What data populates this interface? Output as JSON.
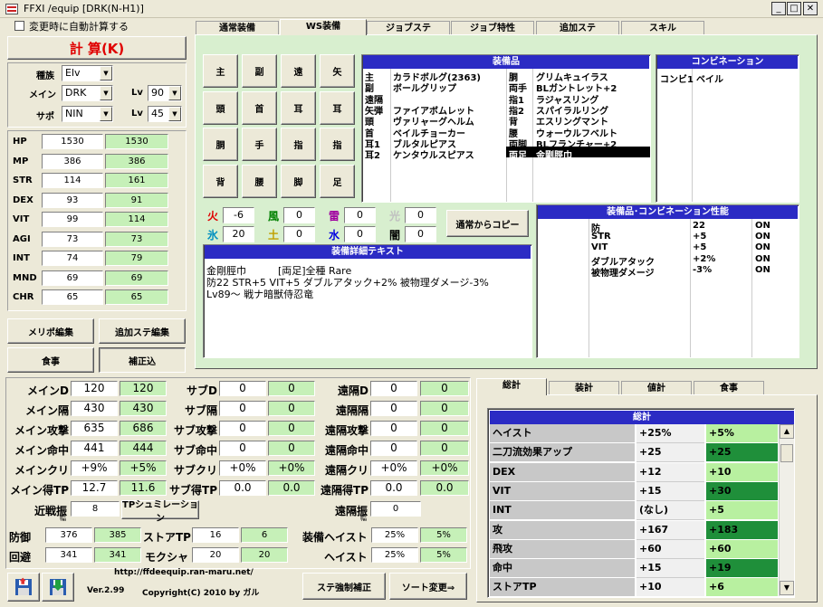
{
  "window": {
    "title": "FFXI /equip [DRK(N-H1)]"
  },
  "autocalc_label": "変更時に自動計算する",
  "calc_button": "計 算(K)",
  "job": {
    "race_label": "種族",
    "race": "Elv",
    "main_label": "メイン",
    "main": "DRK",
    "sub_label": "サポ",
    "sub": "NIN",
    "lv_label": "Lv",
    "main_lv": "90",
    "sub_lv": "45"
  },
  "stats": [
    {
      "name": "HP",
      "base": "1530",
      "total": "1530"
    },
    {
      "name": "MP",
      "base": "386",
      "total": "386"
    },
    {
      "name": "STR",
      "base": "114",
      "total": "161"
    },
    {
      "name": "DEX",
      "base": "93",
      "total": "91"
    },
    {
      "name": "VIT",
      "base": "99",
      "total": "114"
    },
    {
      "name": "AGI",
      "base": "73",
      "total": "73"
    },
    {
      "name": "INT",
      "base": "74",
      "total": "79"
    },
    {
      "name": "MND",
      "base": "69",
      "total": "69"
    },
    {
      "name": "CHR",
      "base": "65",
      "total": "65"
    }
  ],
  "left_buttons": {
    "merit": "メリポ編集",
    "extra": "追加ステ編集",
    "food": "食事",
    "correction": "補正込"
  },
  "tabs": [
    "通常装備",
    "WS装備",
    "ジョブステ",
    "ジョブ特性",
    "追加ステ",
    "スキル"
  ],
  "slots": [
    "主",
    "副",
    "遠",
    "矢",
    "頭",
    "首",
    "耳",
    "耳",
    "胴",
    "手",
    "指",
    "指",
    "背",
    "腰",
    "脚",
    "足"
  ],
  "equip": {
    "header": "装備品",
    "left": [
      {
        "slot": "主",
        "item": "カラドボルグ(2363)"
      },
      {
        "slot": "副",
        "item": "ボールグリップ"
      },
      {
        "slot": "遠隔",
        "item": ""
      },
      {
        "slot": "矢弾",
        "item": "ファイアボムレット"
      },
      {
        "slot": "頭",
        "item": "ヴァリャーグヘルム"
      },
      {
        "slot": "首",
        "item": "ベイルチョーカー"
      },
      {
        "slot": "耳1",
        "item": "ブルタルピアス"
      },
      {
        "slot": "耳2",
        "item": "ケンタウルスピアス"
      }
    ],
    "right": [
      {
        "slot": "胴",
        "item": "グリムキュイラス"
      },
      {
        "slot": "両手",
        "item": "BLガントレット+2"
      },
      {
        "slot": "指1",
        "item": "ラジャスリング"
      },
      {
        "slot": "指2",
        "item": "スパイラルリング"
      },
      {
        "slot": "背",
        "item": "エスリングマント"
      },
      {
        "slot": "腰",
        "item": "ウォーウルフベルト"
      },
      {
        "slot": "両脚",
        "item": "BLフランチャー+2"
      },
      {
        "slot": "両足",
        "item": "金剛脛巾"
      }
    ]
  },
  "combination": {
    "header": "コンビネーション",
    "rows": [
      {
        "name": "コンビ1",
        "value": "ベイル"
      }
    ]
  },
  "elements": [
    {
      "name": "火",
      "value": "-6",
      "color": "#e00000"
    },
    {
      "name": "風",
      "value": "0",
      "color": "#008000"
    },
    {
      "name": "雷",
      "value": "0",
      "color": "#a000a0"
    },
    {
      "name": "光",
      "value": "0",
      "color": "#c0c0c0"
    },
    {
      "name": "氷",
      "value": "20",
      "color": "#0090c0"
    },
    {
      "name": "土",
      "value": "0",
      "color": "#c0a000"
    },
    {
      "name": "水",
      "value": "0",
      "color": "#0000e0"
    },
    {
      "name": "闇",
      "value": "0",
      "color": "#000000"
    }
  ],
  "copy_button": "通常からコピー",
  "combo_perf": {
    "header": "装備品･コンビネーション性能",
    "rows": [
      {
        "name": "防",
        "value": "22",
        "state": "ON"
      },
      {
        "name": "STR",
        "value": "+5",
        "state": "ON"
      },
      {
        "name": "VIT",
        "value": "+5",
        "state": "ON"
      },
      {
        "name": "ダブルアタック",
        "value": "+2%",
        "state": "ON"
      },
      {
        "name": "被物理ダメージ",
        "value": "-3%",
        "state": "ON"
      }
    ]
  },
  "detail": {
    "header": "装備詳細テキスト",
    "lines": [
      "金剛脛巾          [両足]全種 Rare",
      "防22 STR+5 VIT+5 ダブルアタック+2% 被物理ダメージ-3%",
      "Lv89～ 戦ナ暗獣侍忍竜"
    ]
  },
  "combat": {
    "rows": [
      [
        {
          "l": "メインD",
          "a": "120",
          "b": "120"
        },
        {
          "l": "サブD",
          "a": "0",
          "b": "0"
        },
        {
          "l": "遠隔D",
          "a": "0",
          "b": "0"
        }
      ],
      [
        {
          "l": "メイン隔",
          "a": "430",
          "b": "430"
        },
        {
          "l": "サブ隔",
          "a": "0",
          "b": "0"
        },
        {
          "l": "遠隔隔",
          "a": "0",
          "b": "0"
        }
      ],
      [
        {
          "l": "メイン攻撃",
          "a": "635",
          "b": "686"
        },
        {
          "l": "サブ攻撃",
          "a": "0",
          "b": "0"
        },
        {
          "l": "遠隔攻撃",
          "a": "0",
          "b": "0"
        }
      ],
      [
        {
          "l": "メイン命中",
          "a": "441",
          "b": "444"
        },
        {
          "l": "サブ命中",
          "a": "0",
          "b": "0"
        },
        {
          "l": "遠隔命中",
          "a": "0",
          "b": "0"
        }
      ],
      [
        {
          "l": "メインクリ",
          "a": "+9%",
          "b": "+5%"
        },
        {
          "l": "サブクリ",
          "a": "+0%",
          "b": "+0%"
        },
        {
          "l": "遠隔クリ",
          "a": "+0%",
          "b": "+0%"
        }
      ],
      [
        {
          "l": "メイン得TP",
          "a": "12.7",
          "b": "11.6"
        },
        {
          "l": "サブ得TP",
          "a": "0.0",
          "b": "0.0"
        },
        {
          "l": "遠隔得TP",
          "a": "0.0",
          "b": "0.0"
        }
      ]
    ],
    "melee_label": "近戦振",
    "melee_sub": "幅",
    "melee_value": "8",
    "tp_sim_button": "TPシュミレーション",
    "ranged_label": "遠隔振",
    "ranged_sub": "幅",
    "ranged_value": "0",
    "defense_label": "防御",
    "defense_a": "376",
    "defense_b": "385",
    "evasion_label": "回避",
    "evasion_a": "341",
    "evasion_b": "341",
    "storetp_label": "ストアTP",
    "storetp_a": "16",
    "storetp_b": "6",
    "moxa_label": "モクシャ",
    "moxa_a": "20",
    "moxa_b": "20",
    "eqhaste_label": "装備ヘイスト",
    "eqhaste_a": "25%",
    "eqhaste_b": "5%",
    "haste_label": "ヘイスト",
    "haste_a": "25%",
    "haste_b": "5%"
  },
  "footer": {
    "url": "http://ffdeequip.ran-maru.net/",
    "version": "Ver.2.99",
    "copyright": "Copyright(C) 2010 by ガル",
    "force_button": "ステ強制補正",
    "sort_button": "ソート変更⇒"
  },
  "summary_tabs": [
    "総計",
    "装計",
    "値計",
    "食事"
  ],
  "summary": {
    "header": "総計",
    "rows": [
      {
        "name": "ヘイスト",
        "a": "+25%",
        "b": "+5%"
      },
      {
        "name": "二刀流効果アップ",
        "a": "+25",
        "b": "+25"
      },
      {
        "name": "DEX",
        "a": "+12",
        "b": "+10"
      },
      {
        "name": "VIT",
        "a": "+15",
        "b": "+30"
      },
      {
        "name": "INT",
        "a": "(なし)",
        "b": "+5"
      },
      {
        "name": "攻",
        "a": "+167",
        "b": "+183"
      },
      {
        "name": "飛攻",
        "a": "+60",
        "b": "+60"
      },
      {
        "name": "命中",
        "a": "+15",
        "b": "+19"
      },
      {
        "name": "ストアTP",
        "a": "+10",
        "b": "+6"
      }
    ]
  }
}
